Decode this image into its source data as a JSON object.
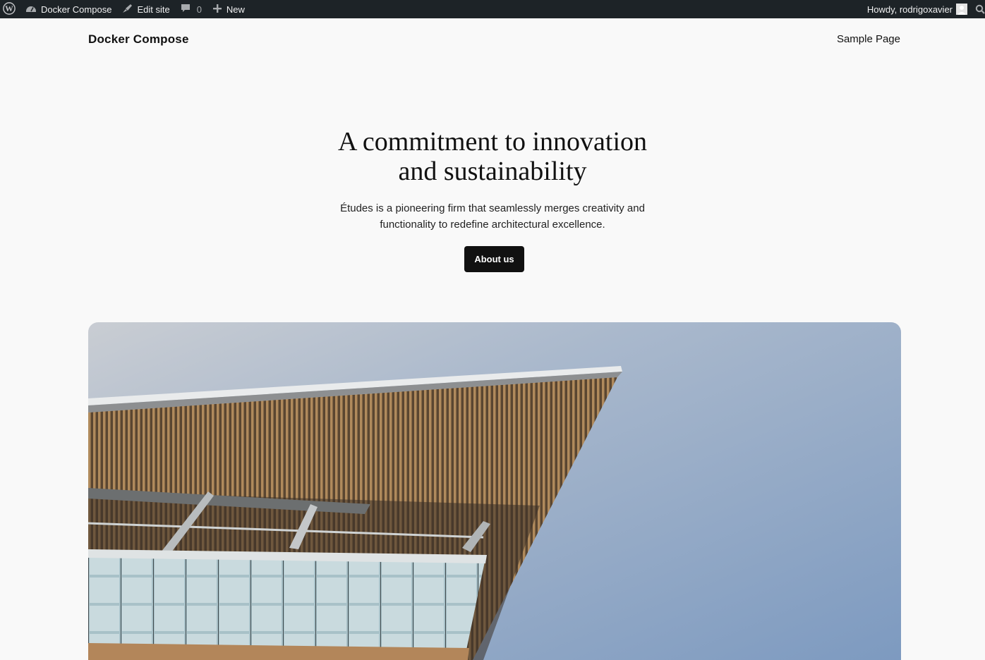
{
  "adminbar": {
    "site_name": "Docker Compose",
    "edit_label": "Edit site",
    "comments_count": "0",
    "new_label": "New",
    "howdy": "Howdy, rodrigoxavier"
  },
  "header": {
    "site_title": "Docker Compose",
    "nav": [
      "Sample Page"
    ]
  },
  "hero": {
    "title_line1": "A commitment to innovation",
    "title_line2": "and sustainability",
    "text_line1": "Études is a pioneering firm that seamlessly merges creativity and",
    "text_line2": "functionality to redefine architectural excellence.",
    "button_label": "About us"
  },
  "colors": {
    "adminbar_bg": "#1d2327",
    "page_bg": "#f9f9f9",
    "button_bg": "#111111"
  },
  "icons": [
    "wordpress-icon",
    "dashboard-icon",
    "edit-brush-icon",
    "comment-icon",
    "plus-icon",
    "avatar-icon",
    "search-icon"
  ]
}
